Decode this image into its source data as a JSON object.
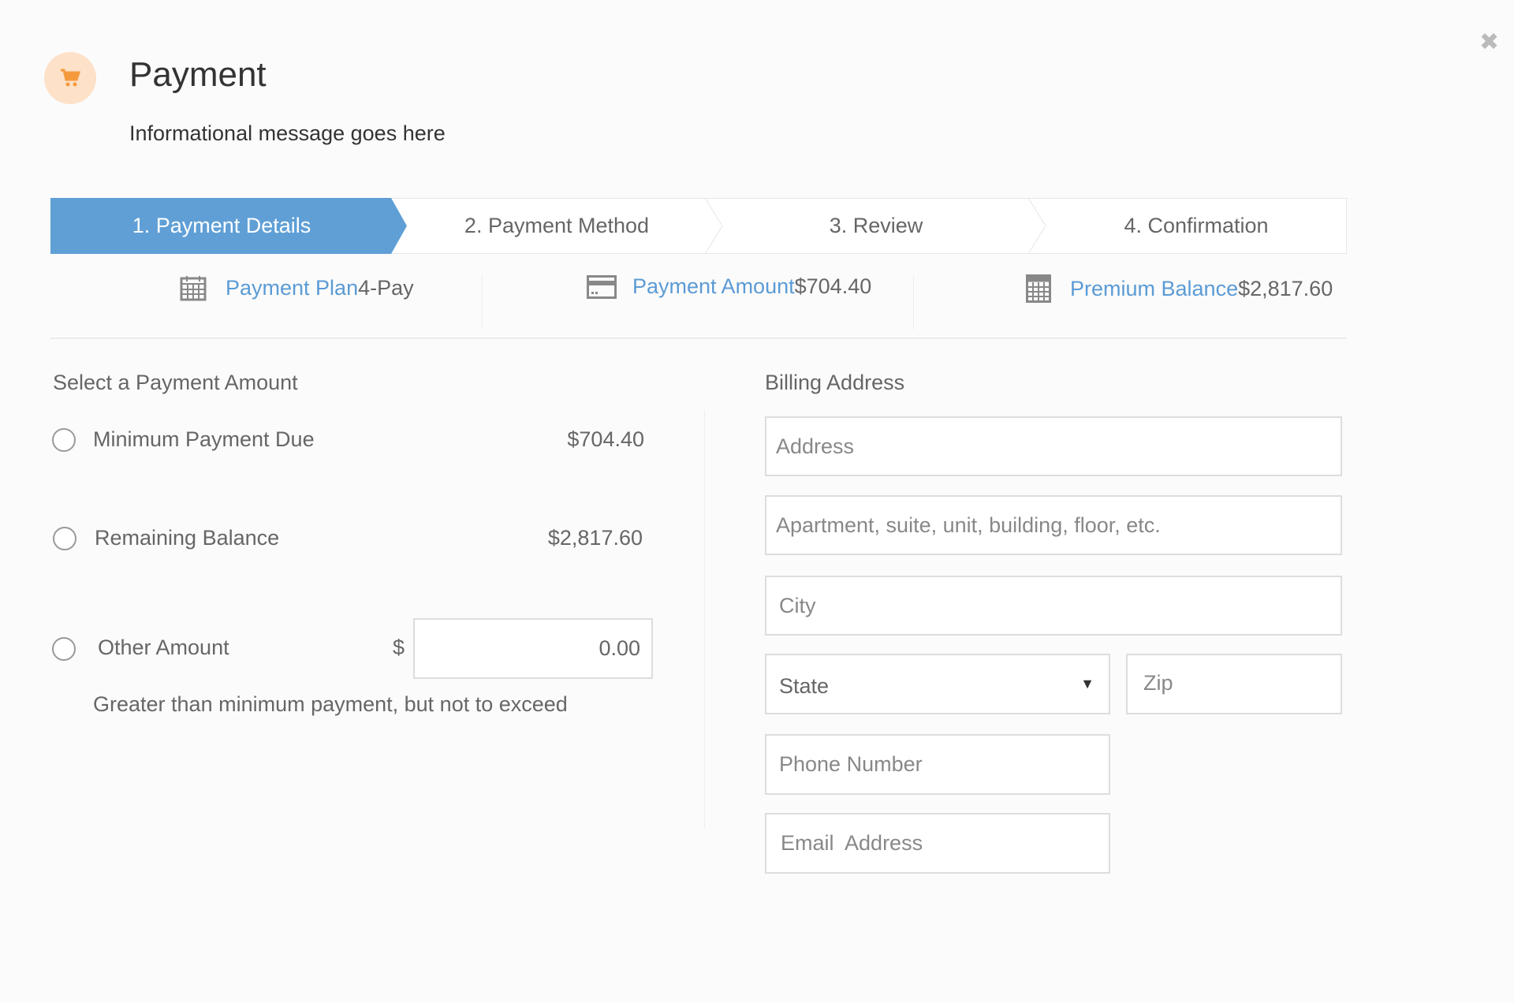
{
  "header": {
    "title": "Payment",
    "info": "Informational message goes here",
    "icon": "shopping-cart-icon",
    "close_icon": "close-icon"
  },
  "steps": [
    {
      "label": "1. Payment Details",
      "active": true
    },
    {
      "label": "2. Payment Method"
    },
    {
      "label": "3. Review"
    },
    {
      "label": "4. Confirmation"
    }
  ],
  "summary": [
    {
      "icon": "calendar-icon",
      "label": "Payment Plan",
      "value": "4-Pay"
    },
    {
      "icon": "credit-card-icon",
      "label": "Payment Amount",
      "value": "$704.40"
    },
    {
      "icon": "calculator-icon",
      "label": "Premium Balance",
      "value": "$2,817.60"
    }
  ],
  "amount": {
    "heading": "Select a Payment Amount",
    "options": [
      {
        "label": "Minimum Payment Due",
        "value": "$704.40"
      },
      {
        "label": "Remaining Balance",
        "value": "$2,817.60"
      },
      {
        "label": "Other Amount",
        "currency": "$",
        "input_value": "0.00"
      }
    ],
    "hint": "Greater than minimum payment, but not to exceed"
  },
  "billing": {
    "heading": "Billing Address",
    "address": "Address",
    "address2": "Apartment, suite, unit, building, floor, etc.",
    "city": "City",
    "state": "State",
    "zip": "Zip",
    "phone": "Phone Number",
    "email": "Email  Address"
  },
  "colors": {
    "accent": "#5f9fd6",
    "cart": "#f59a3c",
    "cart_bg": "#fde1c8"
  }
}
